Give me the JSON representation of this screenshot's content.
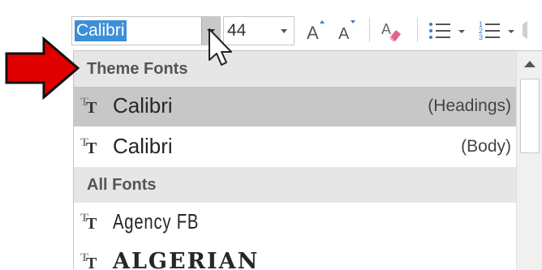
{
  "toolbar": {
    "font_name": "Calibri",
    "font_size": "44",
    "icons": [
      "grow-font-icon",
      "shrink-font-icon",
      "clear-formatting-icon",
      "bullets-icon",
      "numbering-icon"
    ],
    "grow_glyph": "A",
    "shrink_glyph": "A",
    "accent_selection": "#3c8fd8"
  },
  "dropdown": {
    "sections": [
      {
        "header": "Theme Fonts",
        "items": [
          {
            "label": "Calibri",
            "note": "(Headings)",
            "selected": true
          },
          {
            "label": "Calibri",
            "note": "(Body)",
            "selected": false
          }
        ]
      },
      {
        "header": "All Fonts",
        "items": [
          {
            "label": "Agency FB",
            "note": ""
          },
          {
            "label": "ALGERIAN",
            "note": ""
          }
        ]
      }
    ],
    "truetype_glyph": "T"
  },
  "annotation": {
    "arrow_color": "#e00000"
  }
}
